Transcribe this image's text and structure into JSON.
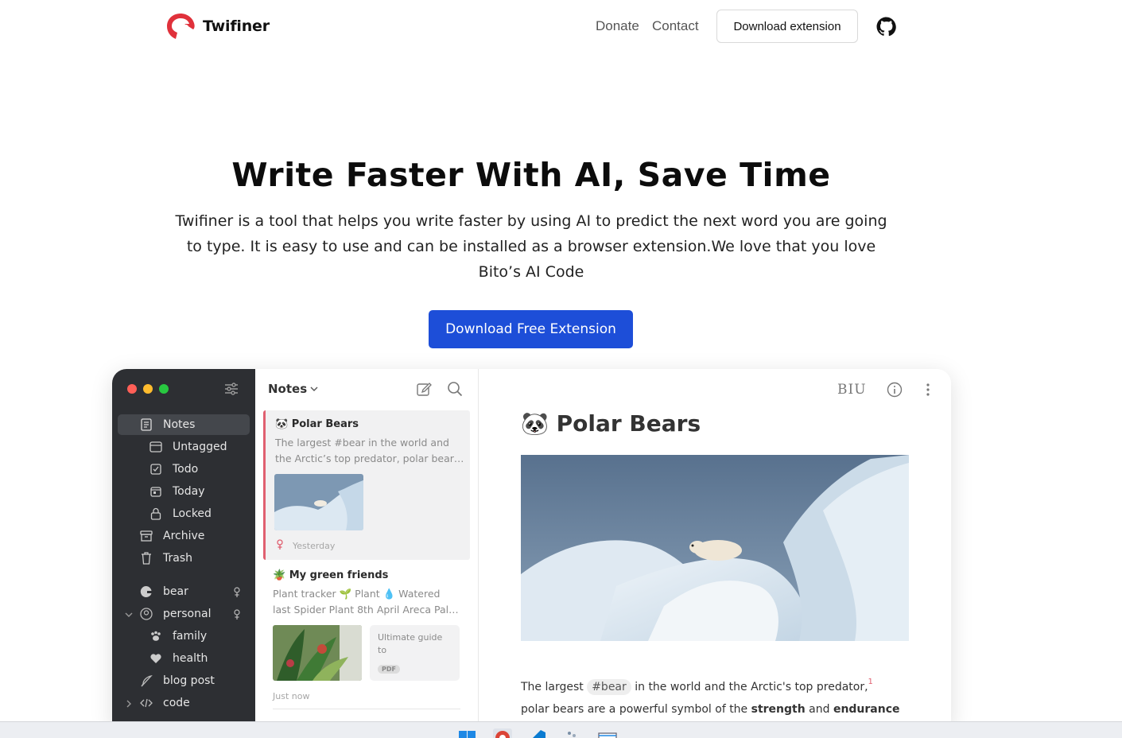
{
  "nav": {
    "brand": "Twifiner",
    "links": [
      "Donate",
      "Contact"
    ],
    "download_label": "Download extension",
    "github_icon": "github-icon"
  },
  "hero": {
    "title": "Write Faster With AI, Save Time",
    "subtitle": "Twifiner is a tool that helps you write faster by using AI to predict the next word you are going to type. It is easy to use and can be installed as a browser extension.We love that you love Bito’s AI Code",
    "cta": "Download Free Extension"
  },
  "app": {
    "sidebar": {
      "items": [
        {
          "label": "Notes",
          "icon": "notes-icon"
        },
        {
          "label": "Untagged",
          "icon": "untagged-icon"
        },
        {
          "label": "Todo",
          "icon": "checkbox-icon"
        },
        {
          "label": "Today",
          "icon": "calendar-icon"
        },
        {
          "label": "Locked",
          "icon": "lock-icon"
        },
        {
          "label": "Archive",
          "icon": "archive-icon"
        },
        {
          "label": "Trash",
          "icon": "trash-icon"
        }
      ],
      "tags": [
        {
          "label": "bear",
          "icon": "bear-icon"
        },
        {
          "label": "personal",
          "icon": "personal-icon"
        },
        {
          "label": "family",
          "icon": "paw-icon"
        },
        {
          "label": "health",
          "icon": "heart-icon"
        },
        {
          "label": "blog post",
          "icon": "feather-icon"
        },
        {
          "label": "code",
          "icon": "code-icon"
        }
      ]
    },
    "list": {
      "header": "Notes",
      "notes": [
        {
          "title": "🐼 Polar Bears",
          "line1": "The largest #bear in the world and",
          "line2": "the Arctic’s top predator, polar bear…",
          "meta": "Yesterday"
        },
        {
          "title": "🪴 My green friends",
          "line1": "Plant tracker 🌱 Plant 💧 Watered",
          "line2": "last Spider Plant 8th April Areca Pal…",
          "attachment_title": "Ultimate guide to",
          "attachment_type": "PDF",
          "meta": "Just now"
        }
      ]
    },
    "editor": {
      "format_label": "BIU",
      "title": "🐼 Polar Bears",
      "body_before_tag": "The largest ",
      "tag": "#bear",
      "body_after_tag": " in the world and the Arctic's top predator,",
      "footnote": "1",
      "body_line2_start": "polar bears are a powerful symbol of the ",
      "bold1": "strength",
      "mid": " and ",
      "bold2": "endurance"
    }
  },
  "colors": {
    "accent": "#1d4ed8",
    "sidebar_bg": "#2d2f33",
    "note_marker": "#e06070",
    "traffic": [
      "#ff5f57",
      "#febc2e",
      "#28c840"
    ]
  }
}
